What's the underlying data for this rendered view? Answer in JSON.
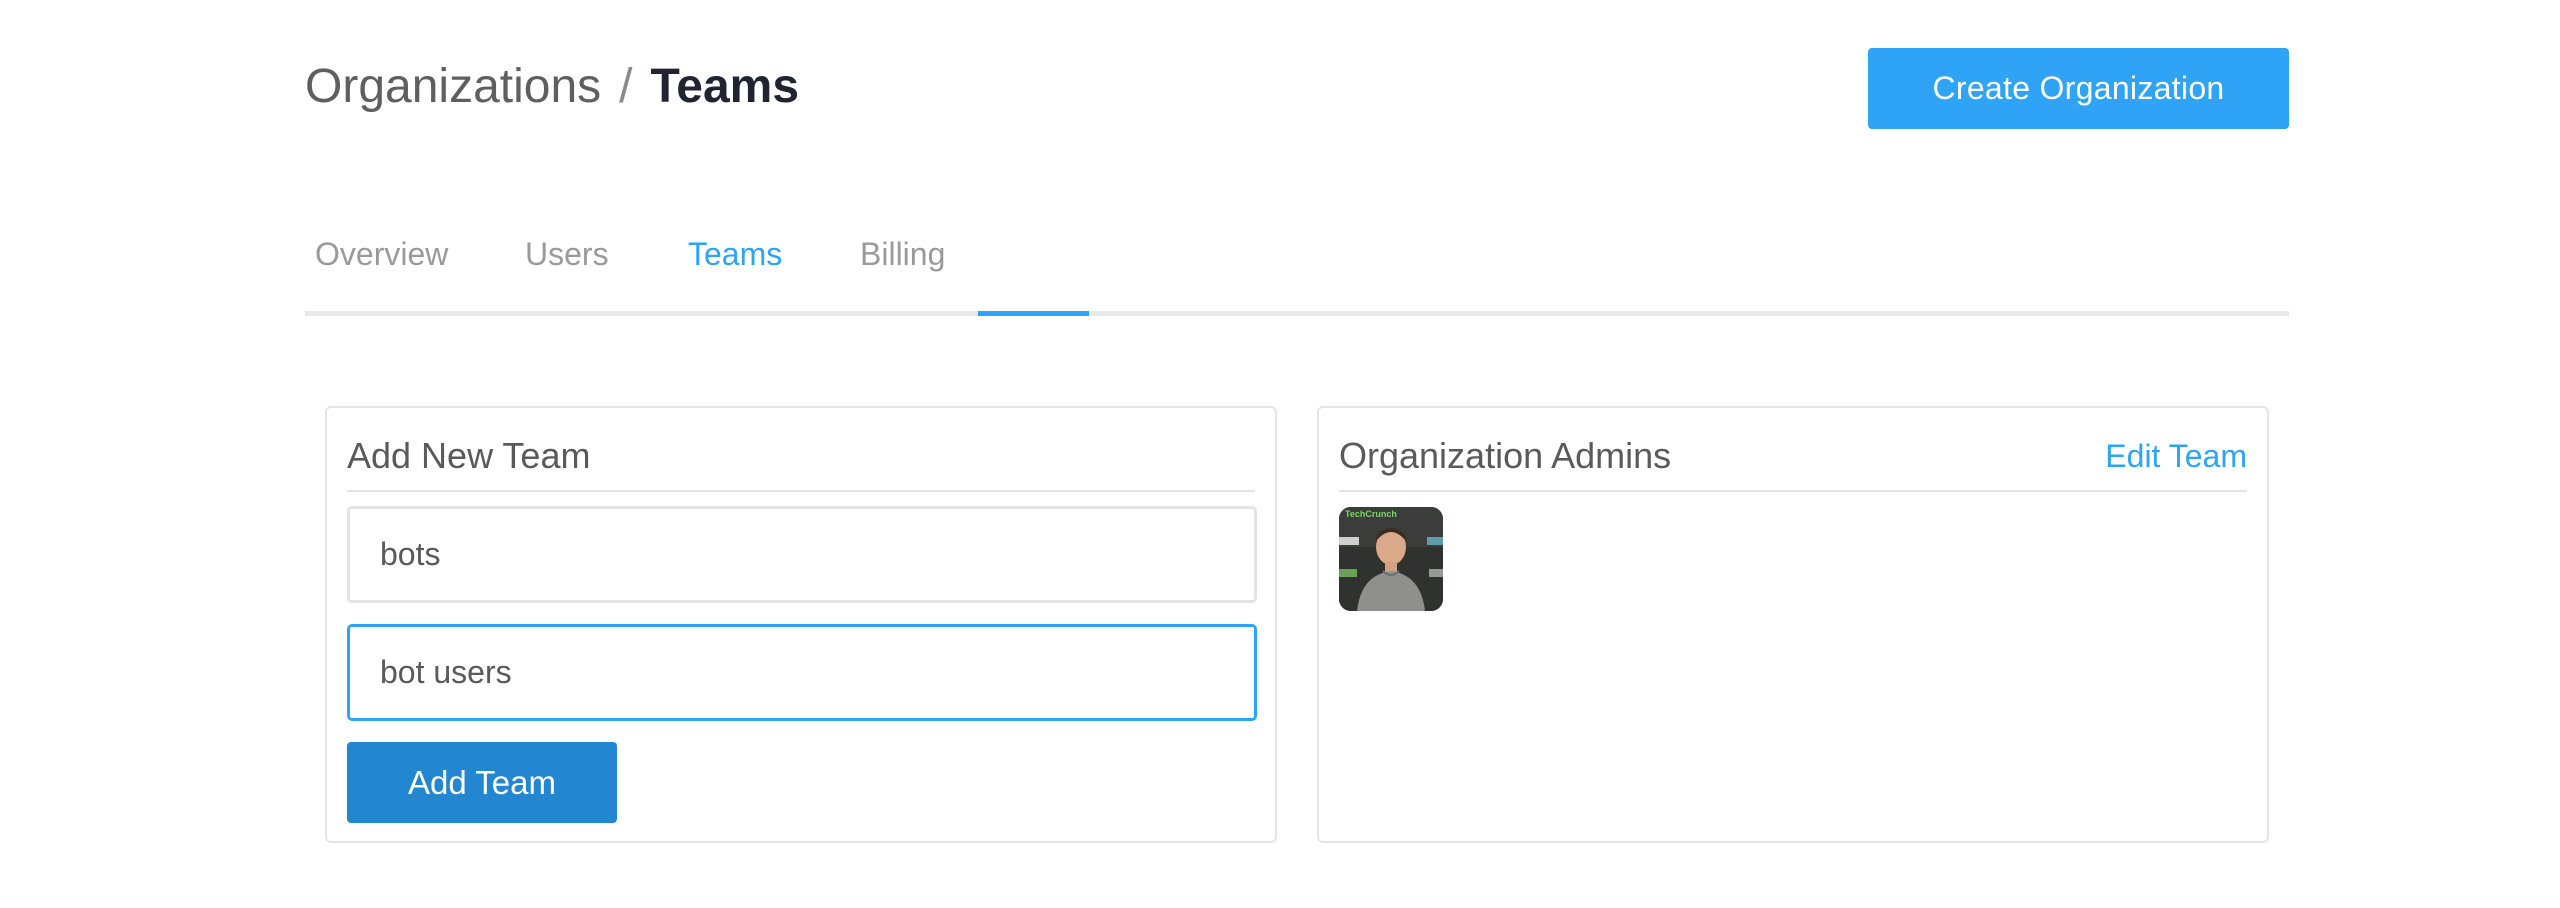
{
  "header": {
    "breadcrumb_parent": "Organizations",
    "breadcrumb_separator": "/",
    "breadcrumb_current": "Teams",
    "create_button_label": "Create Organization"
  },
  "tabs": [
    {
      "label": "Overview",
      "active": false
    },
    {
      "label": "Users",
      "active": false
    },
    {
      "label": "Teams",
      "active": true
    },
    {
      "label": "Billing",
      "active": false
    }
  ],
  "add_team_panel": {
    "title": "Add New Team",
    "team_name_value": "bots",
    "team_description_value": "bot users",
    "add_button_label": "Add Team"
  },
  "admins_panel": {
    "title": "Organization Admins",
    "edit_link_label": "Edit Team",
    "admins": [
      {
        "avatar_icon": "user-avatar",
        "backdrop_text": "TechCrunch"
      }
    ]
  },
  "colors": {
    "accent": "#2fa3f6",
    "add_button": "#2386d0",
    "text": "#4a4a4a",
    "border": "#e5e5e5"
  }
}
